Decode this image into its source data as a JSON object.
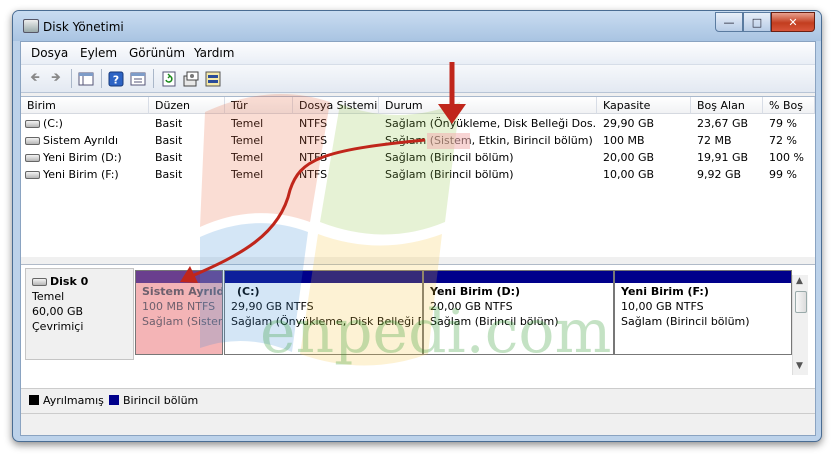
{
  "window": {
    "title": "Disk Yönetimi"
  },
  "menu": [
    "Dosya",
    "Eylem",
    "Görünüm",
    "Yardım"
  ],
  "table": {
    "columns": [
      "Birim",
      "Düzen",
      "Tür",
      "Dosya Sistemi",
      "Durum",
      "Kapasite",
      "Boş Alan",
      "% Boş"
    ],
    "rows": [
      [
        "(C:)",
        "Basit",
        "Temel",
        "NTFS",
        "Sağlam (Önyükleme, Disk Belleği Dos...",
        "29,90 GB",
        "23,67 GB",
        "79 %"
      ],
      [
        "Sistem Ayrıldı",
        "Basit",
        "Temel",
        "NTFS",
        "Sağlam (Sistem, Etkin, Birincil bölüm)",
        "100 MB",
        "72 MB",
        "72 %"
      ],
      [
        "Yeni Birim (D:)",
        "Basit",
        "Temel",
        "NTFS",
        "Sağlam (Birincil bölüm)",
        "20,00 GB",
        "19,91 GB",
        "100 %"
      ],
      [
        "Yeni Birim (F:)",
        "Basit",
        "Temel",
        "NTFS",
        "Sağlam (Birincil bölüm)",
        "10,00 GB",
        "9,92 GB",
        "99 %"
      ]
    ]
  },
  "disk": {
    "name": "Disk 0",
    "type": "Temel",
    "size": "60,00 GB",
    "status": "Çevrimiçi",
    "partitions": [
      {
        "name": "Sistem Ayrıld",
        "size": "100 MB NTFS",
        "status": "Sağlam (Sister"
      },
      {
        "name": "(C:)",
        "size": "29,90 GB NTFS",
        "status": "Sağlam (Önyükleme, Disk Belleği D"
      },
      {
        "name": "Yeni Birim  (D:)",
        "size": "20,00 GB NTFS",
        "status": "Sağlam (Birincil bölüm)"
      },
      {
        "name": "Yeni Birim  (F:)",
        "size": "10,00 GB NTFS",
        "status": "Sağlam (Birincil bölüm)"
      }
    ]
  },
  "legend": [
    {
      "label": "Ayrılmamış",
      "color": "#000000"
    },
    {
      "label": "Birincil bölüm",
      "color": "#00008b"
    }
  ],
  "watermark": "enpedi.com",
  "colors": {
    "highlight": "#f2b0b0",
    "annotation": "#c0261b"
  }
}
